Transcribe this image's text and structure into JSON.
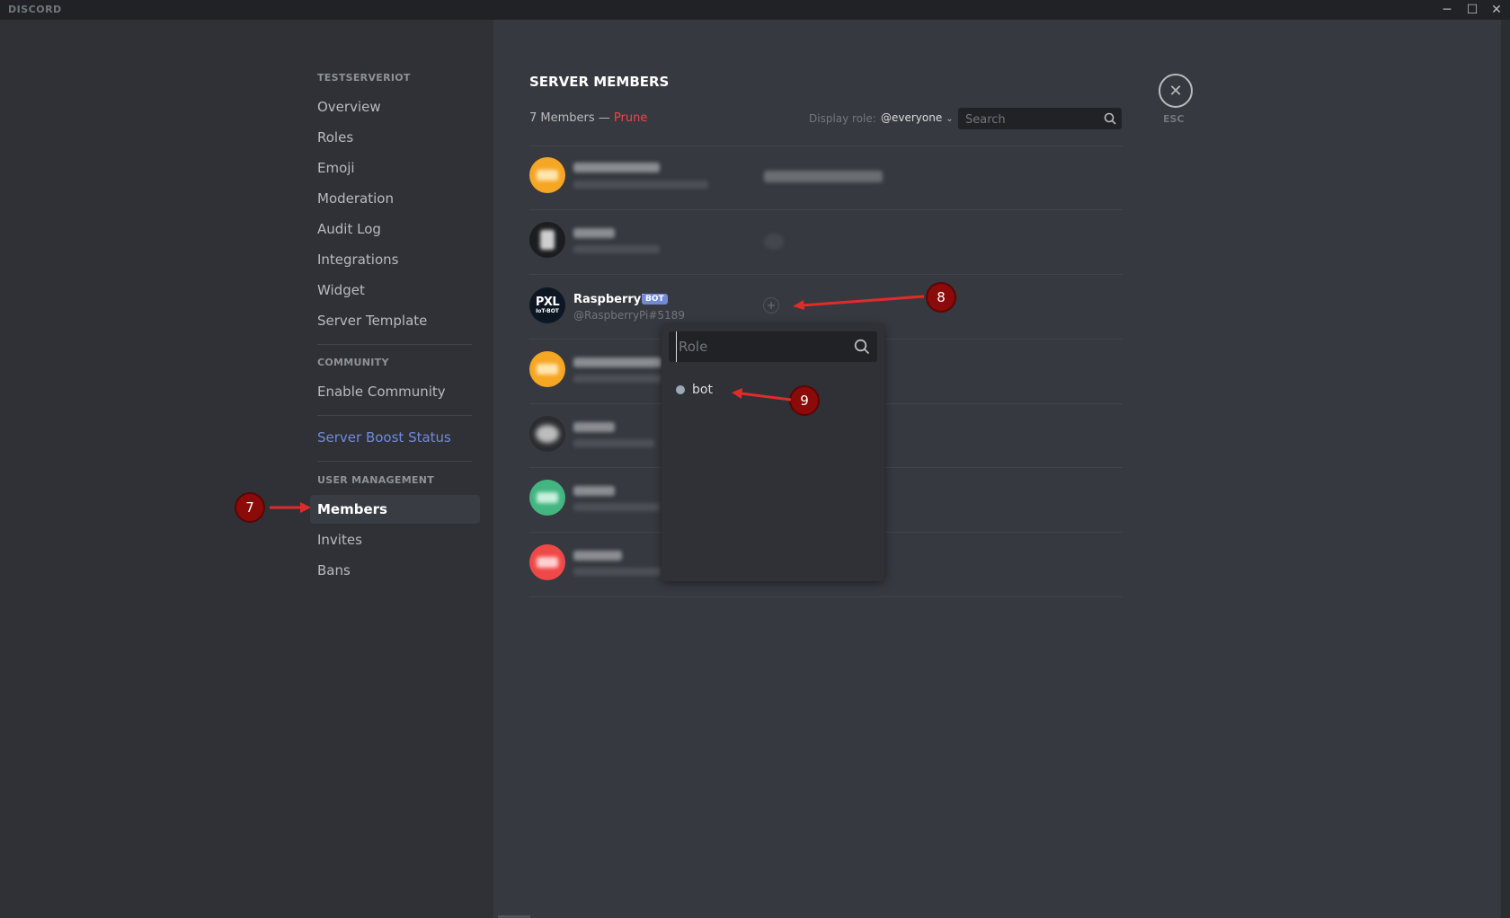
{
  "app": {
    "name": "DISCORD"
  },
  "window_controls": {
    "minimize": "─",
    "maximize": "☐",
    "close": "✕"
  },
  "sidebar": {
    "server_header": "TESTSERVERIOT",
    "server_items": [
      {
        "label": "Overview"
      },
      {
        "label": "Roles"
      },
      {
        "label": "Emoji"
      },
      {
        "label": "Moderation"
      },
      {
        "label": "Audit Log"
      },
      {
        "label": "Integrations"
      },
      {
        "label": "Widget"
      },
      {
        "label": "Server Template"
      }
    ],
    "community_header": "COMMUNITY",
    "community_items": [
      {
        "label": "Enable Community"
      }
    ],
    "boost_label": "Server Boost Status",
    "user_mgmt_header": "USER MANAGEMENT",
    "user_mgmt_items": [
      {
        "label": "Members",
        "active": true
      },
      {
        "label": "Invites"
      },
      {
        "label": "Bans"
      }
    ]
  },
  "main": {
    "title": "SERVER MEMBERS",
    "members_count": "7 Members —",
    "prune_label": "Prune",
    "display_role_label": "Display role:",
    "display_role_value": "@everyone",
    "search_placeholder": "Search",
    "close_label": "ESC",
    "featured_member": {
      "name": "RaspberryPi",
      "tag": "BOT",
      "handle": "@RaspberryPi#5189",
      "avatar_text": "PXL",
      "avatar_subtext": "IoT-BOT"
    },
    "role_popout": {
      "search_placeholder": "Role",
      "roles": [
        {
          "name": "bot"
        }
      ]
    }
  },
  "annotations": {
    "markers": [
      "7",
      "8",
      "9"
    ],
    "color": "#8b0a0a"
  },
  "colors": {
    "accent": "#7289da",
    "danger": "#f04747",
    "sidebar_bg": "#2f3136",
    "content_bg": "#36393f",
    "titlebar_bg": "#202225"
  }
}
